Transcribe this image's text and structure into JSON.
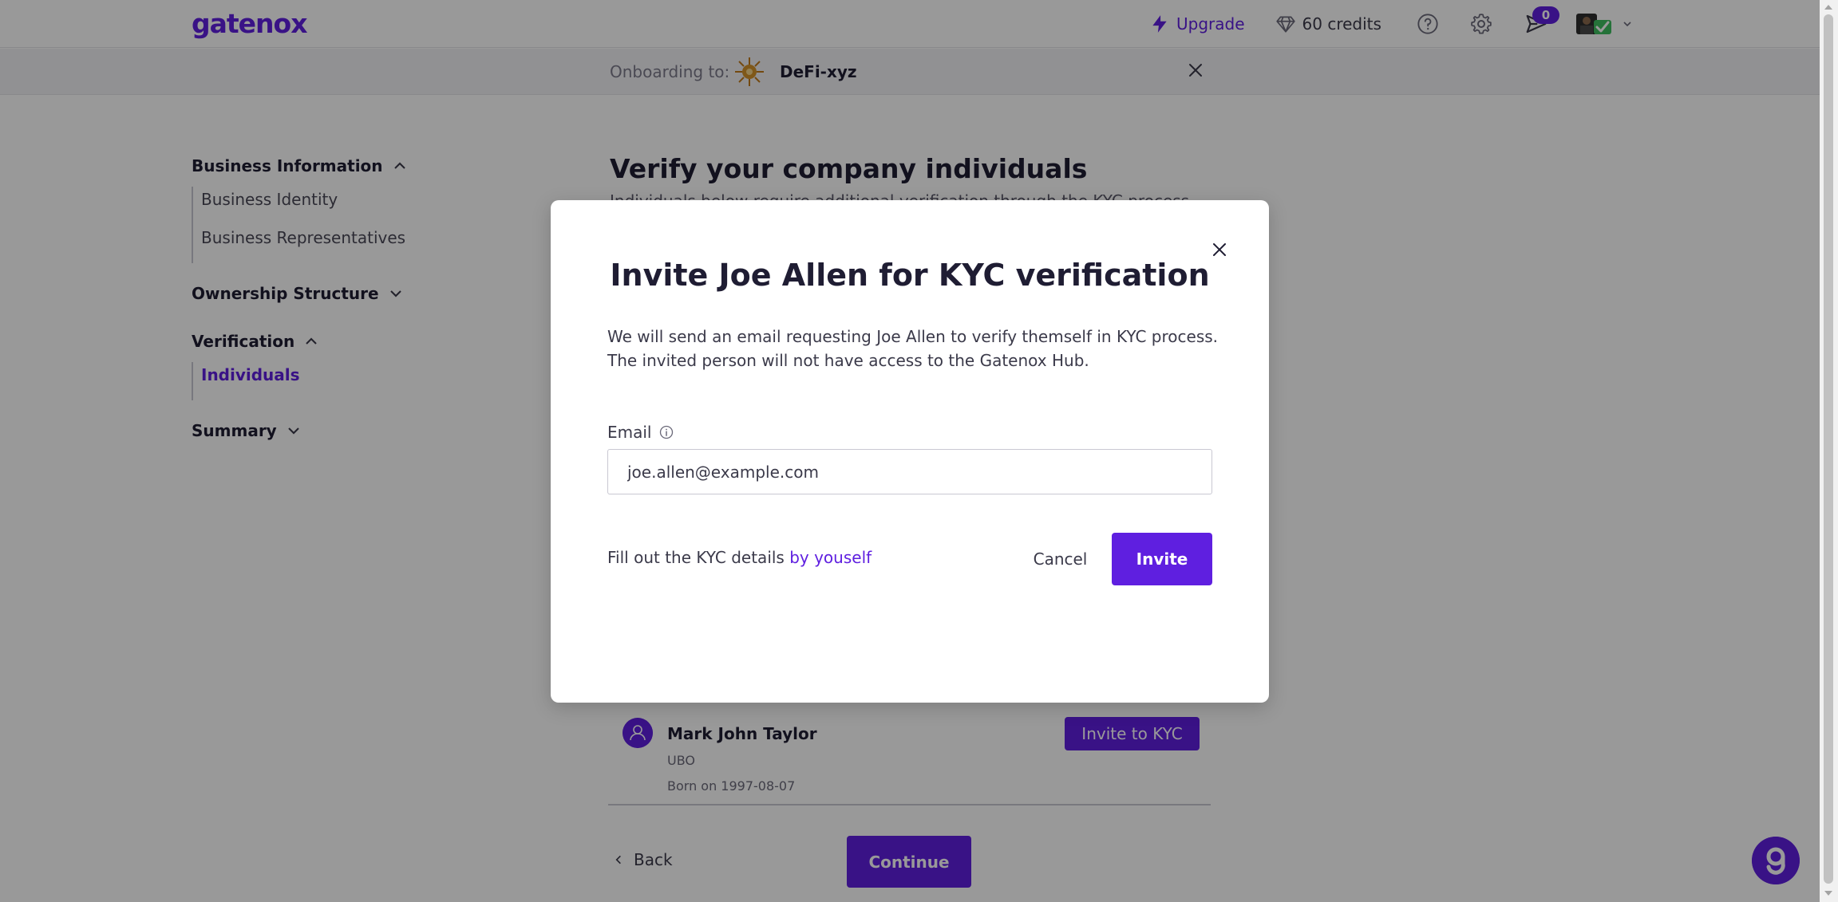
{
  "app": {
    "logo": "gatenox"
  },
  "topnav": {
    "upgrade_label": "Upgrade",
    "credits_label": "60 credits",
    "notifications_count": "0"
  },
  "onboarding": {
    "label": "Onboarding to:",
    "company": "DeFi-xyz"
  },
  "sidebar": {
    "sections": [
      {
        "label": "Business Information",
        "expanded": true,
        "items": [
          {
            "label": "Business Identity"
          },
          {
            "label": "Business Representatives"
          }
        ]
      },
      {
        "label": "Ownership Structure",
        "expanded": false
      },
      {
        "label": "Verification",
        "expanded": true,
        "items": [
          {
            "label": "Individuals",
            "active": true
          }
        ]
      },
      {
        "label": "Summary",
        "expanded": false
      }
    ]
  },
  "main": {
    "title": "Verify your company individuals",
    "subtitle": "Individuals below require additional verification through the KYC process. We",
    "person": {
      "name": "Mark John Taylor",
      "role": "UBO",
      "born": "Born on 1997-08-07",
      "invite_label": "Invite to KYC"
    },
    "back_label": "Back",
    "continue_label": "Continue"
  },
  "modal": {
    "title": "Invite Joe Allen for KYC verification",
    "description": "We will send an email requesting Joe Allen to verify themself in KYC process. The invited person will not have access to the Gatenox Hub.",
    "email_label": "Email",
    "email_value": "joe.allen@example.com",
    "fill_out_prefix": "Fill out the KYC details",
    "fill_out_link": "by youself",
    "cancel_label": "Cancel",
    "invite_label": "Invite"
  },
  "colors": {
    "accent": "#5f1fe0",
    "text": "#1f1d33",
    "overlay": "rgba(0,0,0,0.4)"
  }
}
